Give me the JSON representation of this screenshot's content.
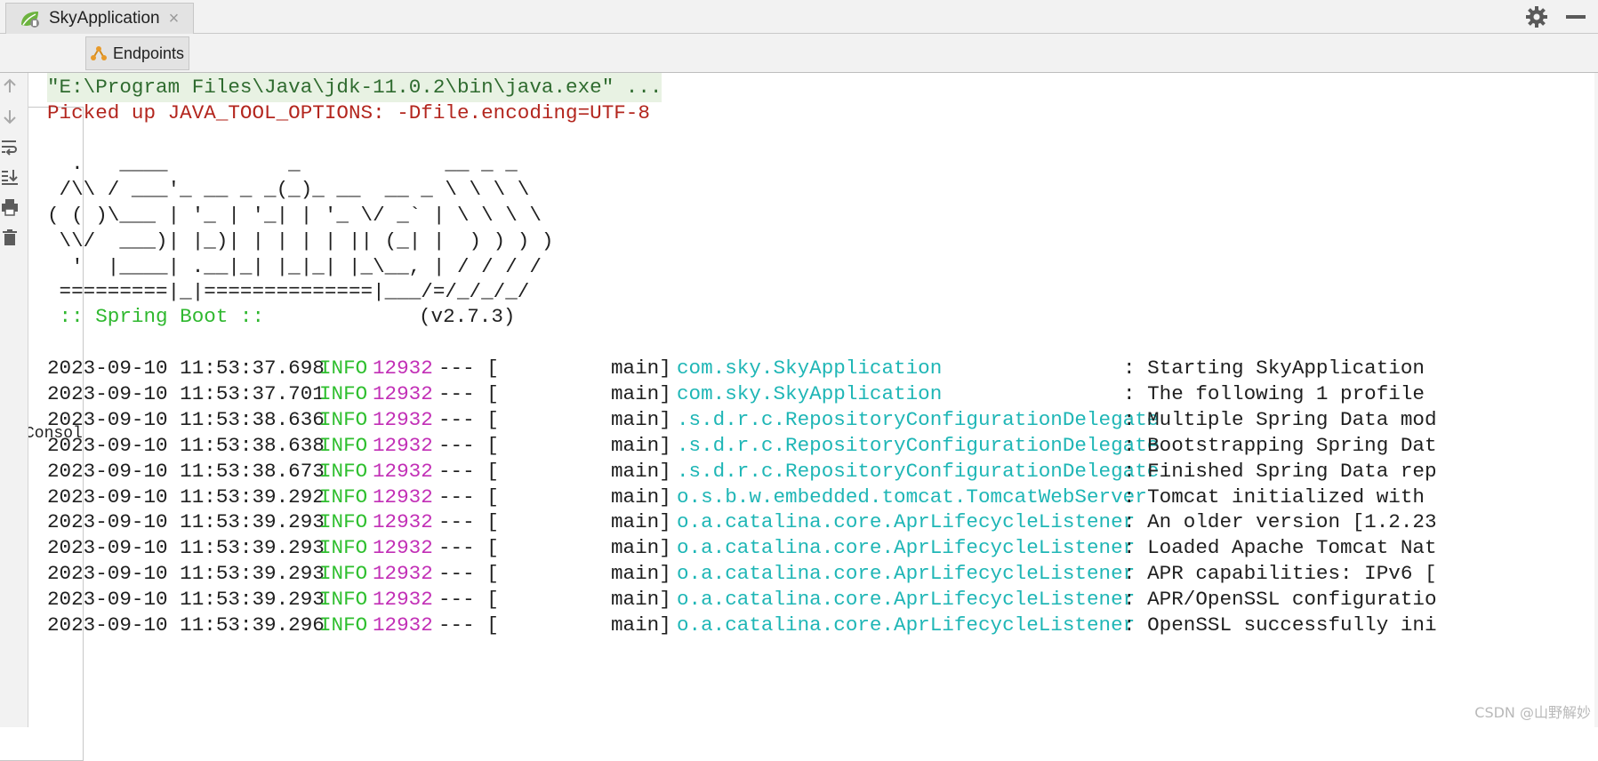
{
  "top_tab": {
    "label": "SkyApplication",
    "close": "×"
  },
  "sub_tabs": {
    "console": "Console",
    "endpoints": "Endpoints"
  },
  "console": {
    "command_line": "\"E:\\Program Files\\Java\\jdk-11.0.2\\bin\\java.exe\" ...",
    "tool_options_line": "Picked up JAVA_TOOL_OPTIONS: -Dfile.encoding=UTF-8",
    "banner": [
      "  .   ____          _            __ _ _",
      " /\\\\ / ___'_ __ _ _(_)_ __  __ _ \\ \\ \\ \\",
      "( ( )\\___ | '_ | '_| | '_ \\/ _` | \\ \\ \\ \\",
      " \\\\/  ___)| |_)| | | | | || (_| |  ) ) ) )",
      "  '  |____| .__|_| |_|_| |_\\__, | / / / /",
      " =========|_|==============|___/=/_/_/_/"
    ],
    "spring_boot_label": " :: Spring Boot ::",
    "spring_boot_version": "(v2.7.3)",
    "log_rows": [
      {
        "ts": "2023-09-10 11:53:37.698",
        "level": "INFO",
        "pid": "12932",
        "sep": "--- [",
        "thread": "main]",
        "logger": "com.sky.SkyApplication",
        "message": ": Starting SkyApplication"
      },
      {
        "ts": "2023-09-10 11:53:37.701",
        "level": "INFO",
        "pid": "12932",
        "sep": "--- [",
        "thread": "main]",
        "logger": "com.sky.SkyApplication",
        "message": ": The following 1 profile"
      },
      {
        "ts": "2023-09-10 11:53:38.636",
        "level": "INFO",
        "pid": "12932",
        "sep": "--- [",
        "thread": "main]",
        "logger": ".s.d.r.c.RepositoryConfigurationDelegate",
        "message": ": Multiple Spring Data mod"
      },
      {
        "ts": "2023-09-10 11:53:38.638",
        "level": "INFO",
        "pid": "12932",
        "sep": "--- [",
        "thread": "main]",
        "logger": ".s.d.r.c.RepositoryConfigurationDelegate",
        "message": ": Bootstrapping Spring Dat"
      },
      {
        "ts": "2023-09-10 11:53:38.673",
        "level": "INFO",
        "pid": "12932",
        "sep": "--- [",
        "thread": "main]",
        "logger": ".s.d.r.c.RepositoryConfigurationDelegate",
        "message": ": Finished Spring Data rep"
      },
      {
        "ts": "2023-09-10 11:53:39.292",
        "level": "INFO",
        "pid": "12932",
        "sep": "--- [",
        "thread": "main]",
        "logger": "o.s.b.w.embedded.tomcat.TomcatWebServer",
        "message": ": Tomcat initialized with"
      },
      {
        "ts": "2023-09-10 11:53:39.293",
        "level": "INFO",
        "pid": "12932",
        "sep": "--- [",
        "thread": "main]",
        "logger": "o.a.catalina.core.AprLifecycleListener",
        "message": ": An older version [1.2.23"
      },
      {
        "ts": "2023-09-10 11:53:39.293",
        "level": "INFO",
        "pid": "12932",
        "sep": "--- [",
        "thread": "main]",
        "logger": "o.a.catalina.core.AprLifecycleListener",
        "message": ": Loaded Apache Tomcat Nat"
      },
      {
        "ts": "2023-09-10 11:53:39.293",
        "level": "INFO",
        "pid": "12932",
        "sep": "--- [",
        "thread": "main]",
        "logger": "o.a.catalina.core.AprLifecycleListener",
        "message": ": APR capabilities: IPv6 ["
      },
      {
        "ts": "2023-09-10 11:53:39.293",
        "level": "INFO",
        "pid": "12932",
        "sep": "--- [",
        "thread": "main]",
        "logger": "o.a.catalina.core.AprLifecycleListener",
        "message": ": APR/OpenSSL configuratio"
      },
      {
        "ts": "2023-09-10 11:53:39.296",
        "level": "INFO",
        "pid": "12932",
        "sep": "--- [",
        "thread": "main]",
        "logger": "o.a.catalina.core.AprLifecycleListener",
        "message": ": OpenSSL successfully ini"
      }
    ]
  },
  "watermark": "CSDN @山野解妙",
  "colors": {
    "command_bg": "#e8f2e3",
    "command_text": "#2f6b2f",
    "tool_options": "#b3261e",
    "spring_boot": "#2fb82f",
    "level_info": "#2fbf2f",
    "pid": "#c22fb6",
    "logger": "#1fb6b6"
  },
  "icons": {
    "run_tab": "spring-leaf-icon",
    "console_tab": "console-icon",
    "endpoints_tab": "endpoints-icon",
    "settings": "gear-icon",
    "hide": "minimize-icon",
    "gutter": [
      "up-arrow-icon",
      "down-arrow-icon",
      "soft-wrap-icon",
      "scroll-to-end-icon",
      "print-icon",
      "trash-icon"
    ]
  }
}
